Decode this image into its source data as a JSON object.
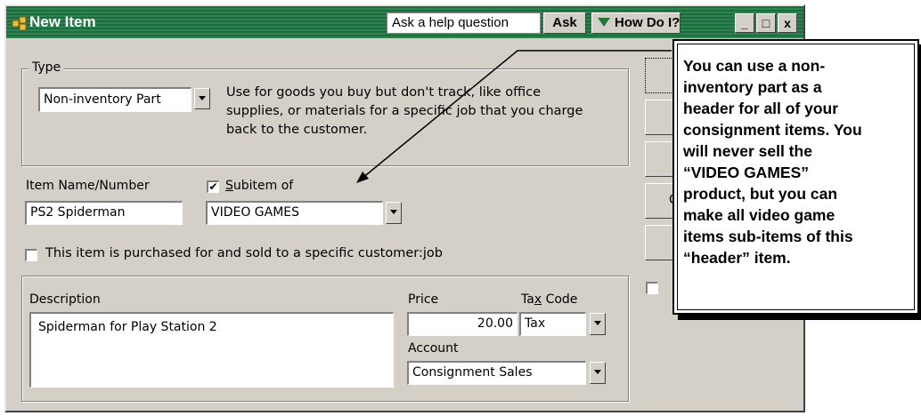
{
  "window": {
    "title": "New Item",
    "help_placeholder": "Ask a help question",
    "ask_label": "Ask",
    "how_do_i_label": "How Do I?",
    "minimize_label": "_",
    "maximize_label": "□",
    "close_label": "x"
  },
  "type_group": {
    "legend": "Type",
    "selected": "Non-inventory Part",
    "description": "Use for goods you buy but don't track, like office supplies, or materials for a specific job that you charge back to the customer."
  },
  "item": {
    "name_label": "Item Name/Number",
    "name_value": "PS2 Spiderman",
    "subitem_label_prefix": "",
    "subitem_label_underline": "S",
    "subitem_label_rest": "ubitem of",
    "subitem_checked_mark": "✔",
    "subitem_value": "VIDEO GAMES",
    "specific_customer_label": "This item is purchased for and sold to a specific customer:job"
  },
  "details": {
    "description_label": "Description",
    "description_value": "Spiderman for Play Station 2",
    "price_label": "Price",
    "price_value": "20.00",
    "tax_code_label_a": "Ta",
    "tax_code_label_u": "x",
    "tax_code_label_b": " Code",
    "tax_code_value": "Tax",
    "account_label": "Account",
    "account_value": "Consignment Sales"
  },
  "side_buttons": {
    "c_label": "C"
  },
  "callout": {
    "text_lines": [
      "You can use a non-",
      "inventory part as a",
      "header for all of your",
      "consignment items. You",
      "will never sell the",
      "“VIDEO GAMES”",
      "product, but you can",
      "make all video game",
      "items sub-items of this",
      "“header” item."
    ]
  },
  "colors": {
    "titlebar": "#1f6b3e",
    "dialog_bg": "#d4d0c8"
  }
}
